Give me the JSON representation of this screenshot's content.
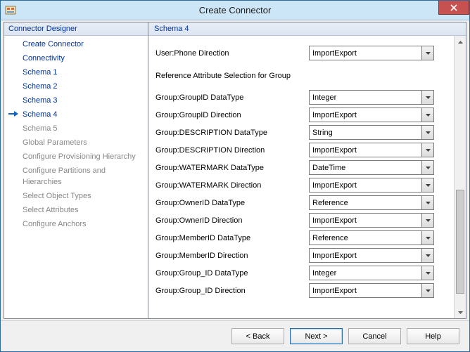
{
  "window": {
    "title": "Create Connector"
  },
  "nav": {
    "header": "Connector Designer",
    "items": [
      {
        "label": "Create Connector",
        "state": "done"
      },
      {
        "label": "Connectivity",
        "state": "done"
      },
      {
        "label": "Schema 1",
        "state": "done"
      },
      {
        "label": "Schema 2",
        "state": "done"
      },
      {
        "label": "Schema 3",
        "state": "done"
      },
      {
        "label": "Schema 4",
        "state": "current"
      },
      {
        "label": "Schema 5",
        "state": "pending"
      },
      {
        "label": "Global Parameters",
        "state": "pending"
      },
      {
        "label": "Configure Provisioning Hierarchy",
        "state": "pending"
      },
      {
        "label": "Configure Partitions and Hierarchies",
        "state": "pending"
      },
      {
        "label": "Select Object Types",
        "state": "pending"
      },
      {
        "label": "Select Attributes",
        "state": "pending"
      },
      {
        "label": "Configure Anchors",
        "state": "pending"
      }
    ]
  },
  "content": {
    "header": "Schema 4",
    "top_row": {
      "label": "User:Phone Direction",
      "value": "ImportExport"
    },
    "section_heading": "Reference Attribute Selection for Group",
    "rows": [
      {
        "label": "Group:GroupID DataType",
        "value": "Integer"
      },
      {
        "label": "Group:GroupID Direction",
        "value": "ImportExport"
      },
      {
        "label": "Group:DESCRIPTION DataType",
        "value": "String"
      },
      {
        "label": "Group:DESCRIPTION Direction",
        "value": "ImportExport"
      },
      {
        "label": "Group:WATERMARK DataType",
        "value": "DateTime"
      },
      {
        "label": "Group:WATERMARK Direction",
        "value": "ImportExport"
      },
      {
        "label": "Group:OwnerID DataType",
        "value": "Reference"
      },
      {
        "label": "Group:OwnerID Direction",
        "value": "ImportExport"
      },
      {
        "label": "Group:MemberID DataType",
        "value": "Reference"
      },
      {
        "label": "Group:MemberID Direction",
        "value": "ImportExport"
      },
      {
        "label": "Group:Group_ID DataType",
        "value": "Integer"
      },
      {
        "label": "Group:Group_ID Direction",
        "value": "ImportExport"
      }
    ]
  },
  "buttons": {
    "back": "<  Back",
    "next": "Next  >",
    "cancel": "Cancel",
    "help": "Help"
  }
}
